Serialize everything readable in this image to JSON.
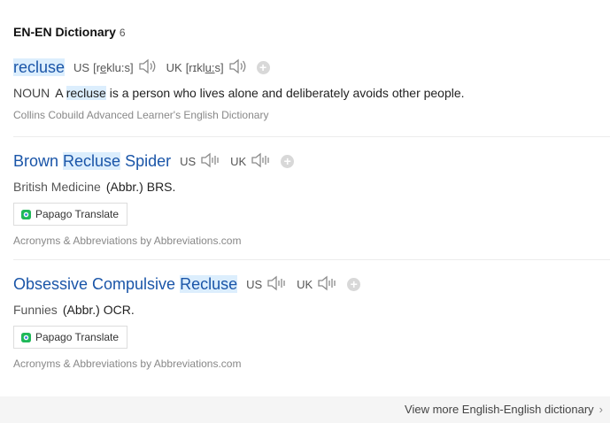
{
  "section": {
    "title": "EN-EN Dictionary",
    "count": "6"
  },
  "entries": [
    {
      "head": {
        "pre": "",
        "hl": "recluse",
        "post": ""
      },
      "us_label": "US",
      "us_ipa_pre": "[r",
      "us_ipa_u": "e",
      "us_ipa_post": "klu:s]",
      "uk_label": "UK",
      "uk_ipa_pre": "[rɪkl",
      "uk_ipa_u": "u:",
      "uk_ipa_post": "s]",
      "pos": "NOUN",
      "def_pre": "A ",
      "def_hl": "recluse",
      "def_post": " is a person who lives alone and deliberately avoids other people.",
      "source": "Collins Cobuild Advanced Learner's English Dictionary"
    },
    {
      "head": {
        "pre": "Brown ",
        "hl": "Recluse",
        "post": " Spider"
      },
      "us_label": "US",
      "uk_label": "UK",
      "tag": "British Medicine",
      "def": "(Abbr.) BRS.",
      "button": "Papago Translate",
      "source": "Acronyms & Abbreviations by Abbreviations.com"
    },
    {
      "head": {
        "pre": "Obsessive Compulsive ",
        "hl": "Recluse",
        "post": ""
      },
      "us_label": "US",
      "uk_label": "UK",
      "tag": "Funnies",
      "def": "(Abbr.) OCR.",
      "button": "Papago Translate",
      "source": "Acronyms & Abbreviations by Abbreviations.com"
    }
  ],
  "footer": {
    "more": "View more English-English dictionary",
    "chevron": "›"
  },
  "icons": {
    "speaker": "speaker-icon",
    "add": "plus-icon",
    "papago": "papago-icon"
  },
  "colors": {
    "headword": "#1a55a8",
    "highlight": "#dceefd"
  }
}
